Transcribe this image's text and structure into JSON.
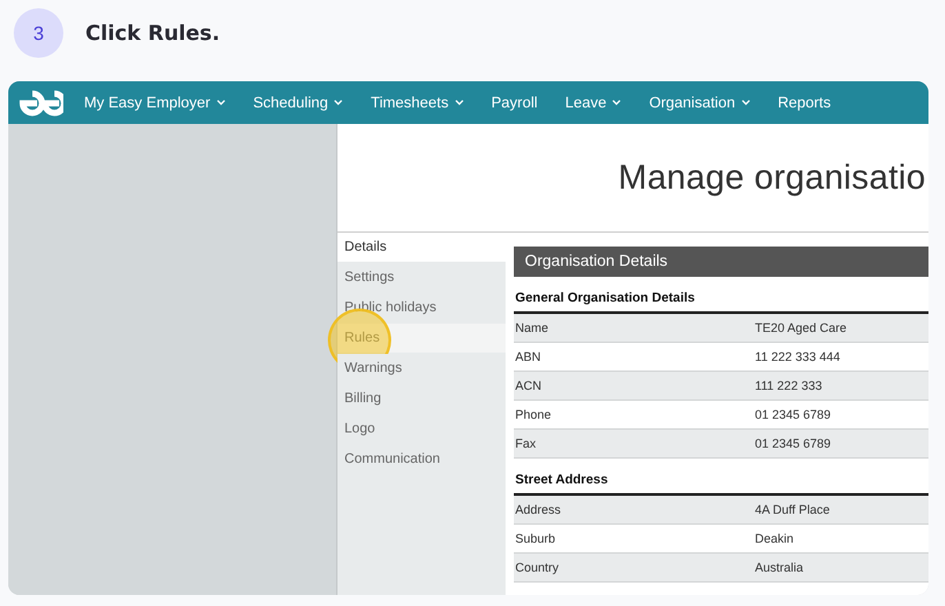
{
  "step": {
    "number": "3",
    "instruction": "Click **Rules**."
  },
  "navbar": {
    "items": [
      {
        "label": "My Easy Employer",
        "dropdown": true
      },
      {
        "label": "Scheduling",
        "dropdown": true
      },
      {
        "label": "Timesheets",
        "dropdown": true
      },
      {
        "label": "Payroll",
        "dropdown": false
      },
      {
        "label": "Leave",
        "dropdown": true
      },
      {
        "label": "Organisation",
        "dropdown": true
      },
      {
        "label": "Reports",
        "dropdown": false
      }
    ]
  },
  "page_title": "Manage organisatio",
  "side_menu": [
    {
      "label": "Details",
      "selected": true,
      "highlighted": false
    },
    {
      "label": "Settings",
      "selected": false,
      "highlighted": false
    },
    {
      "label": "Public holidays",
      "selected": false,
      "highlighted": false
    },
    {
      "label": "Rules",
      "selected": false,
      "highlighted": true
    },
    {
      "label": "Warnings",
      "selected": false,
      "highlighted": false
    },
    {
      "label": "Billing",
      "selected": false,
      "highlighted": false
    },
    {
      "label": "Logo",
      "selected": false,
      "highlighted": false
    },
    {
      "label": "Communication",
      "selected": false,
      "highlighted": false
    }
  ],
  "panel": {
    "title": "Organisation Details",
    "sections": [
      {
        "heading": "General Organisation Details",
        "rows": [
          {
            "label": "Name",
            "value": "TE20 Aged Care"
          },
          {
            "label": "ABN",
            "value": "11 222 333 444"
          },
          {
            "label": "ACN",
            "value": "111 222 333"
          },
          {
            "label": "Phone",
            "value": "01 2345 6789"
          },
          {
            "label": "Fax",
            "value": "01 2345 6789"
          }
        ]
      },
      {
        "heading": "Street Address",
        "rows": [
          {
            "label": "Address",
            "value": "4A Duff Place"
          },
          {
            "label": "Suburb",
            "value": "Deakin"
          },
          {
            "label": "Country",
            "value": "Australia"
          }
        ]
      }
    ]
  }
}
